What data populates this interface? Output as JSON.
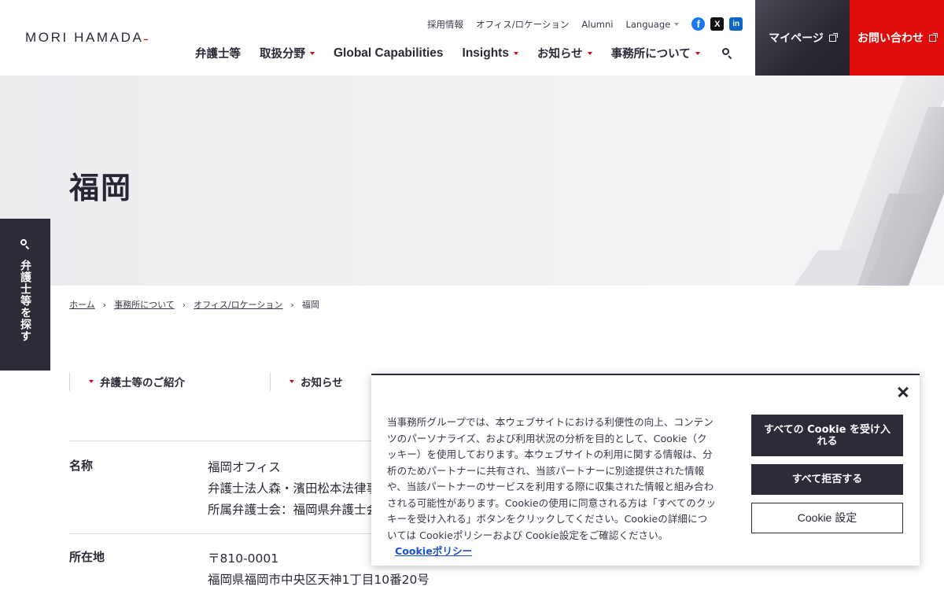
{
  "header": {
    "logo": "MORI HAMADA",
    "utility_nav": [
      "採用情報",
      "オフィス/ロケーション",
      "Alumni"
    ],
    "language_label": "Language",
    "social_icons": [
      "facebook-icon",
      "x-icon",
      "linkedin-icon"
    ],
    "main_nav": [
      {
        "label": "弁護士等",
        "dropdown": false
      },
      {
        "label": "取扱分野",
        "dropdown": true
      },
      {
        "label": "Global Capabilities",
        "dropdown": false
      },
      {
        "label": "Insights",
        "dropdown": true
      },
      {
        "label": "お知らせ",
        "dropdown": true
      },
      {
        "label": "事務所について",
        "dropdown": true
      }
    ],
    "mypage_label": "マイページ",
    "contact_label": "お問い合わせ",
    "colors": {
      "accent_red": "#df0a0a",
      "dark": "#2f2a37"
    }
  },
  "hero": {
    "title": "福岡"
  },
  "side_tab": {
    "label": "弁護士等を探す"
  },
  "breadcrumb": [
    "ホーム",
    "事務所について",
    "オフィス/ロケーション",
    "福岡"
  ],
  "section_nav": [
    "弁護士等のご紹介",
    "お知らせ"
  ],
  "info": {
    "rows": [
      {
        "label": "名称",
        "values": [
          "福岡オフィス",
          "弁護士法人森・濱田松本法律事",
          "所属弁護士会：福岡県弁護士会"
        ]
      },
      {
        "label": "所在地",
        "values": [
          "〒810-0001",
          "福岡県福岡市中央区天神1丁目10番20号"
        ]
      }
    ]
  },
  "cookie_banner": {
    "text": "当事務所グループでは、本ウェブサイトにおける利便性の向上、コンテンツのパーソナライズ、および利用状況の分析を目的として、Cookie（クッキー）を使用しております。本ウェブサイトの利用に関する情報は、分析のためパートナーに共有され、当該パートナーに別途提供された情報や、当該パートナーのサービスを利用する際に収集された情報と組み合わされる可能性があります。Cookieの使用に同意される方は「すべてのクッキーを受け入れる」ボタンをクリックしてください。Cookieの詳細については Cookieポリシーおよび Cookie設定をご確認ください。",
    "policy_link": "Cookieポリシー",
    "accept_all": "すべての Cookie を受け入れる",
    "reject_all": "すべて拒否する",
    "settings": "Cookie 設定"
  }
}
